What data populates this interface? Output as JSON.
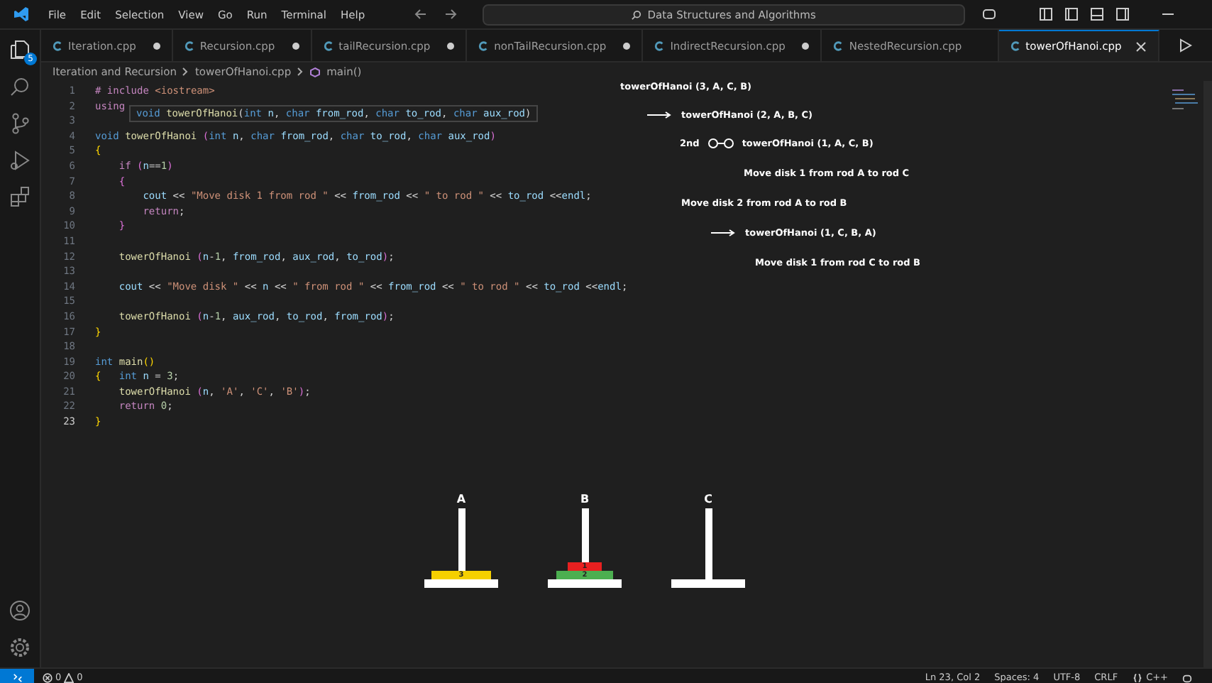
{
  "title_bar": {
    "menus": [
      "File",
      "Edit",
      "Selection",
      "View",
      "Go",
      "Run",
      "Terminal",
      "Help"
    ],
    "search": "Data Structures and Algorithms"
  },
  "activity_bar": {
    "explorer_badge": "5"
  },
  "tabs": [
    {
      "label": "Iteration.cpp",
      "modified": true,
      "selected": false
    },
    {
      "label": "Recursion.cpp",
      "modified": true,
      "selected": false
    },
    {
      "label": "tailRecursion.cpp",
      "modified": true,
      "selected": false
    },
    {
      "label": "nonTailRecursion.cpp",
      "modified": true,
      "selected": false
    },
    {
      "label": "IndirectRecursion.cpp",
      "modified": true,
      "selected": false
    },
    {
      "label": "NestedRecursion.cpp",
      "modified": false,
      "selected": false
    },
    {
      "label": "towerOfHanoi.cpp",
      "modified": false,
      "selected": true
    }
  ],
  "breadcrumb": [
    "Iteration and Recursion",
    "towerOfHanoi.cpp",
    "main()"
  ],
  "hover_tooltip": [
    {
      "kind": "kw",
      "text": "void "
    },
    {
      "kind": "fn",
      "text": "towerOfHanoi"
    },
    {
      "kind": "p",
      "text": "("
    },
    {
      "kind": "kw",
      "text": "int "
    },
    {
      "kind": "var",
      "text": "n"
    },
    {
      "kind": "p",
      "text": ", "
    },
    {
      "kind": "kw",
      "text": "char "
    },
    {
      "kind": "var",
      "text": "from_rod"
    },
    {
      "kind": "p",
      "text": ", "
    },
    {
      "kind": "kw",
      "text": "char "
    },
    {
      "kind": "var",
      "text": "to_rod"
    },
    {
      "kind": "p",
      "text": ", "
    },
    {
      "kind": "kw",
      "text": "char "
    },
    {
      "kind": "var",
      "text": "aux_rod"
    },
    {
      "kind": "p",
      "text": ")"
    }
  ],
  "code": [
    {
      "number": "1",
      "tokens": [
        {
          "kind": "ctl",
          "text": "# include "
        },
        {
          "kind": "str",
          "text": "<iostream>"
        }
      ]
    },
    {
      "number": "2",
      "tokens": [
        {
          "kind": "ctl",
          "text": "using"
        }
      ]
    },
    {
      "number": "3"
    },
    {
      "number": "4",
      "tokens": [
        {
          "kind": "kw",
          "text": "void "
        },
        {
          "kind": "fn",
          "text": "towerOfHanoi "
        },
        {
          "kind": "br",
          "text": "("
        },
        {
          "kind": "kw",
          "text": "int "
        },
        {
          "kind": "var",
          "text": "n"
        },
        {
          "kind": "p",
          "text": ", "
        },
        {
          "kind": "kw",
          "text": "char "
        },
        {
          "kind": "var",
          "text": "from_rod"
        },
        {
          "kind": "p",
          "text": ", "
        },
        {
          "kind": "kw",
          "text": "char "
        },
        {
          "kind": "var",
          "text": "to_rod"
        },
        {
          "kind": "p",
          "text": ", "
        },
        {
          "kind": "kw",
          "text": "char "
        },
        {
          "kind": "var",
          "text": "aux_rod"
        },
        {
          "kind": "br",
          "text": ")"
        }
      ]
    },
    {
      "number": "5",
      "tokens": [
        {
          "kind": "brace",
          "text": "{"
        }
      ]
    },
    {
      "number": "6",
      "tokens": [
        {
          "kind": "ctl",
          "text": "    if "
        },
        {
          "kind": "br",
          "text": "("
        },
        {
          "kind": "var",
          "text": "n"
        },
        {
          "kind": "p",
          "text": "=="
        },
        {
          "kind": "num",
          "text": "1"
        },
        {
          "kind": "br",
          "text": ")"
        }
      ]
    },
    {
      "number": "7",
      "tokens": [
        {
          "kind": "br",
          "text": "    {"
        }
      ]
    },
    {
      "number": "8",
      "tokens": [
        {
          "kind": "var",
          "text": "        cout"
        },
        {
          "kind": "p",
          "text": " << "
        },
        {
          "kind": "str",
          "text": "\"Move disk 1 from rod \""
        },
        {
          "kind": "p",
          "text": " << "
        },
        {
          "kind": "var",
          "text": "from_rod"
        },
        {
          "kind": "p",
          "text": " << "
        },
        {
          "kind": "str",
          "text": "\" to rod \""
        },
        {
          "kind": "p",
          "text": " << "
        },
        {
          "kind": "var",
          "text": "to_rod"
        },
        {
          "kind": "p",
          "text": " <<"
        },
        {
          "kind": "var",
          "text": "endl"
        },
        {
          "kind": "p",
          "text": ";"
        }
      ]
    },
    {
      "number": "9",
      "tokens": [
        {
          "kind": "ctl",
          "text": "        return"
        },
        {
          "kind": "p",
          "text": ";"
        }
      ]
    },
    {
      "number": "10",
      "tokens": [
        {
          "kind": "br",
          "text": "    }"
        }
      ]
    },
    {
      "number": "11"
    },
    {
      "number": "12",
      "tokens": [
        {
          "kind": "fn",
          "text": "    towerOfHanoi "
        },
        {
          "kind": "br",
          "text": "("
        },
        {
          "kind": "var",
          "text": "n"
        },
        {
          "kind": "p",
          "text": "-"
        },
        {
          "kind": "num",
          "text": "1"
        },
        {
          "kind": "p",
          "text": ", "
        },
        {
          "kind": "var",
          "text": "from_rod"
        },
        {
          "kind": "p",
          "text": ", "
        },
        {
          "kind": "var",
          "text": "aux_rod"
        },
        {
          "kind": "p",
          "text": ", "
        },
        {
          "kind": "var",
          "text": "to_rod"
        },
        {
          "kind": "br",
          "text": ")"
        },
        {
          "kind": "p",
          "text": ";"
        }
      ]
    },
    {
      "number": "13"
    },
    {
      "number": "14",
      "tokens": [
        {
          "kind": "var",
          "text": "    cout"
        },
        {
          "kind": "p",
          "text": " << "
        },
        {
          "kind": "str",
          "text": "\"Move disk \""
        },
        {
          "kind": "p",
          "text": " << "
        },
        {
          "kind": "var",
          "text": "n"
        },
        {
          "kind": "p",
          "text": " << "
        },
        {
          "kind": "str",
          "text": "\" from rod \""
        },
        {
          "kind": "p",
          "text": " << "
        },
        {
          "kind": "var",
          "text": "from_rod"
        },
        {
          "kind": "p",
          "text": " << "
        },
        {
          "kind": "str",
          "text": "\" to rod \""
        },
        {
          "kind": "p",
          "text": " << "
        },
        {
          "kind": "var",
          "text": "to_rod"
        },
        {
          "kind": "p",
          "text": " <<"
        },
        {
          "kind": "var",
          "text": "endl"
        },
        {
          "kind": "p",
          "text": ";"
        }
      ]
    },
    {
      "number": "15"
    },
    {
      "number": "16",
      "tokens": [
        {
          "kind": "fn",
          "text": "    towerOfHanoi "
        },
        {
          "kind": "br",
          "text": "("
        },
        {
          "kind": "var",
          "text": "n"
        },
        {
          "kind": "p",
          "text": "-"
        },
        {
          "kind": "num",
          "text": "1"
        },
        {
          "kind": "p",
          "text": ", "
        },
        {
          "kind": "var",
          "text": "aux_rod"
        },
        {
          "kind": "p",
          "text": ", "
        },
        {
          "kind": "var",
          "text": "to_rod"
        },
        {
          "kind": "p",
          "text": ", "
        },
        {
          "kind": "var",
          "text": "from_rod"
        },
        {
          "kind": "br",
          "text": ")"
        },
        {
          "kind": "p",
          "text": ";"
        }
      ]
    },
    {
      "number": "17",
      "tokens": [
        {
          "kind": "brace",
          "text": "}"
        }
      ]
    },
    {
      "number": "18"
    },
    {
      "number": "19",
      "tokens": [
        {
          "kind": "kw",
          "text": "int "
        },
        {
          "kind": "fn",
          "text": "main"
        },
        {
          "kind": "brace",
          "text": "()"
        }
      ]
    },
    {
      "number": "20",
      "tokens": [
        {
          "kind": "brace",
          "text": "{"
        },
        {
          "kind": "kw",
          "text": "   int "
        },
        {
          "kind": "var",
          "text": "n"
        },
        {
          "kind": "p",
          "text": " = "
        },
        {
          "kind": "num",
          "text": "3"
        },
        {
          "kind": "p",
          "text": ";"
        }
      ]
    },
    {
      "number": "21",
      "tokens": [
        {
          "kind": "fn",
          "text": "    towerOfHanoi "
        },
        {
          "kind": "br",
          "text": "("
        },
        {
          "kind": "var",
          "text": "n"
        },
        {
          "kind": "p",
          "text": ", "
        },
        {
          "kind": "str",
          "text": "'A'"
        },
        {
          "kind": "p",
          "text": ", "
        },
        {
          "kind": "str",
          "text": "'C'"
        },
        {
          "kind": "p",
          "text": ", "
        },
        {
          "kind": "str",
          "text": "'B'"
        },
        {
          "kind": "br",
          "text": ")"
        },
        {
          "kind": "p",
          "text": ";"
        }
      ]
    },
    {
      "number": "22",
      "tokens": [
        {
          "kind": "ctl",
          "text": "    return "
        },
        {
          "kind": "num",
          "text": "0"
        },
        {
          "kind": "p",
          "text": ";"
        }
      ]
    },
    {
      "number": "23",
      "tokens": [
        {
          "kind": "brace",
          "text": "}"
        }
      ]
    }
  ],
  "annotations": [
    {
      "kind": "plain",
      "text": "towerOfHanoi (3, A, C, B)"
    },
    {
      "kind": "arrow",
      "text": "towerOfHanoi (2, A, B, C)"
    },
    {
      "kind": "step",
      "prefix": "2nd",
      "text": "towerOfHanoi (1, A, C, B)"
    },
    {
      "kind": "plain",
      "text": "Move disk 1 from rod A to rod C"
    },
    {
      "kind": "plain",
      "text": "Move disk 2 from rod A to rod B"
    },
    {
      "kind": "arrow",
      "text": "towerOfHanoi (1, C, B, A)"
    },
    {
      "kind": "plain",
      "text": "Move disk 1 from rod C to rod B"
    }
  ],
  "rods": [
    {
      "label": "A",
      "disks": [
        {
          "label": "3",
          "kind": "large",
          "color": "#f5d000"
        }
      ]
    },
    {
      "label": "B",
      "disks": [
        {
          "label": "1",
          "kind": "small",
          "color": "#e82020"
        },
        {
          "label": "2",
          "kind": "medium",
          "color": "#4caf50"
        }
      ]
    },
    {
      "label": "C"
    }
  ],
  "status_bar": {
    "errors": "0",
    "warnings": "0",
    "items": [
      "Ln 23, Col 2",
      "Spaces: 4",
      "UTF-8",
      "CRLF"
    ],
    "language": "C++"
  }
}
